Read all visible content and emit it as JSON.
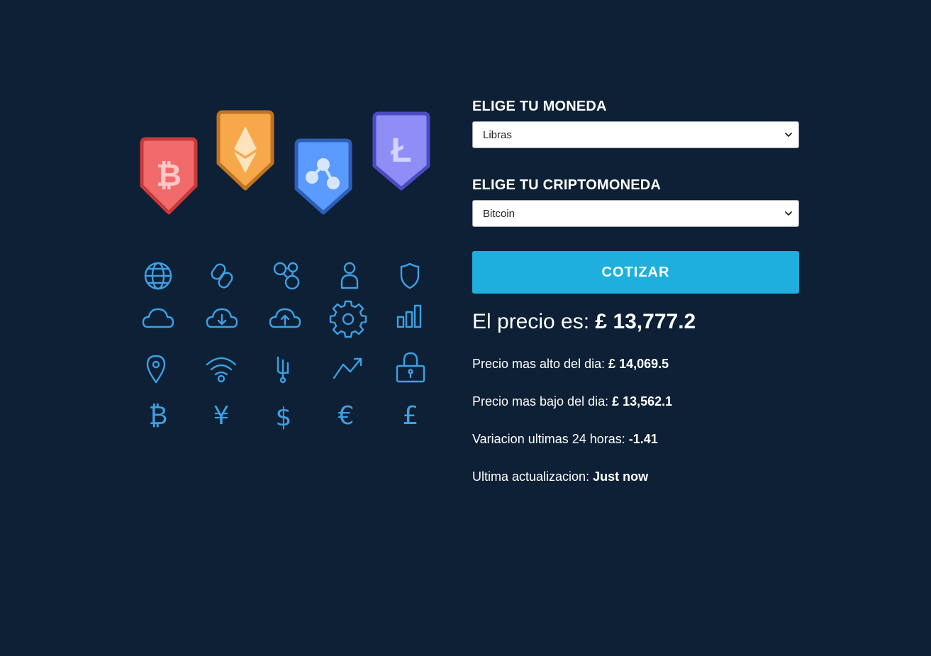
{
  "illustration": {
    "coins": [
      {
        "name": "bitcoin",
        "icon": "bitcoin-icon",
        "color": "#f26b6b",
        "border": "#c83a3a"
      },
      {
        "name": "ethereum",
        "icon": "ethereum-icon",
        "color": "#f7a84b",
        "border": "#c07423"
      },
      {
        "name": "ripple",
        "icon": "ripple-icon",
        "color": "#5b9bff",
        "border": "#2e5fb8"
      },
      {
        "name": "litecoin",
        "icon": "litecoin-icon",
        "color": "#8f8ef7",
        "border": "#4c4bc2"
      }
    ],
    "icon_color": "#3ea0e4",
    "icons": [
      "globe-icon",
      "link-icon",
      "network-icon",
      "user-icon",
      "shield-icon",
      "cloud-icon",
      "cloud-download-icon",
      "cloud-upload-icon",
      "gear-icon",
      "bar-chart-icon",
      "location-pin-icon",
      "wifi-icon",
      "usb-icon",
      "trend-up-icon",
      "lock-icon",
      "bitcoin-symbol-icon",
      "yen-icon",
      "dollar-icon",
      "euro-icon",
      "pound-icon"
    ],
    "currency_symbols": [
      "₿",
      "¥",
      "$",
      "€",
      "£"
    ]
  },
  "form": {
    "currency_label": "ELIGE TU MONEDA",
    "currency_selected": "Libras",
    "crypto_label": "ELIGE TU CRIPTOMONEDA",
    "crypto_selected": "Bitcoin",
    "submit_label": "COTIZAR"
  },
  "result": {
    "price_prefix": "El precio es: ",
    "price_value": "£ 13,777.2",
    "high_prefix": "Precio mas alto del dia: ",
    "high_value": "£ 14,069.5",
    "low_prefix": "Precio mas bajo del dia: ",
    "low_value": "£ 13,562.1",
    "change_prefix": "Variacion ultimas 24 horas: ",
    "change_value": "-1.41",
    "updated_prefix": "Ultima actualizacion: ",
    "updated_value": "Just now"
  },
  "colors": {
    "background": "#0d2035",
    "button": "#1fafdc"
  }
}
